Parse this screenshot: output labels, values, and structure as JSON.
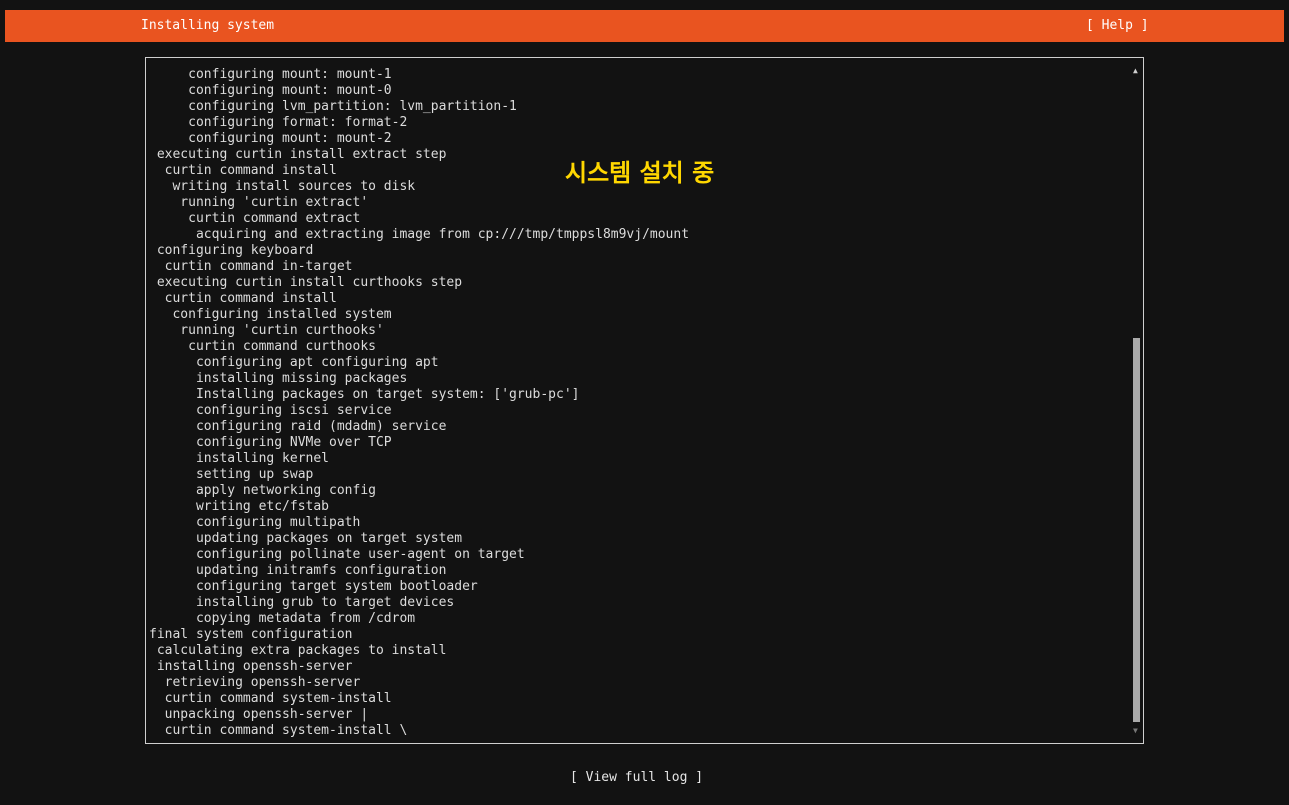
{
  "header": {
    "title": "Installing system",
    "help_label": "[ Help ]",
    "bar_color": "#e95420"
  },
  "overlay": {
    "caption": "시스템 설치 중",
    "color": "#ffd700"
  },
  "log": {
    "lines": [
      "     configuring mount: mount-1",
      "     configuring mount: mount-0",
      "     configuring lvm_partition: lvm_partition-1",
      "     configuring format: format-2",
      "     configuring mount: mount-2",
      " executing curtin install extract step",
      "  curtin command install",
      "   writing install sources to disk",
      "    running 'curtin extract'",
      "     curtin command extract",
      "      acquiring and extracting image from cp:///tmp/tmppsl8m9vj/mount",
      " configuring keyboard",
      "  curtin command in-target",
      " executing curtin install curthooks step",
      "  curtin command install",
      "   configuring installed system",
      "    running 'curtin curthooks'",
      "     curtin command curthooks",
      "      configuring apt configuring apt",
      "      installing missing packages",
      "      Installing packages on target system: ['grub-pc']",
      "      configuring iscsi service",
      "      configuring raid (mdadm) service",
      "      configuring NVMe over TCP",
      "      installing kernel",
      "      setting up swap",
      "      apply networking config",
      "      writing etc/fstab",
      "      configuring multipath",
      "      updating packages on target system",
      "      configuring pollinate user-agent on target",
      "      updating initramfs configuration",
      "      configuring target system bootloader",
      "      installing grub to target devices",
      "      copying metadata from /cdrom",
      "final system configuration",
      " calculating extra packages to install",
      " installing openssh-server",
      "  retrieving openssh-server",
      "  curtin command system-install",
      "  unpacking openssh-server |",
      "  curtin command system-install \\"
    ],
    "scroll_position": 1.0
  },
  "scrollbar": {
    "up_arrow": "▲",
    "down_arrow": "▼"
  },
  "footer": {
    "view_log_label": "[ View full log ]"
  }
}
